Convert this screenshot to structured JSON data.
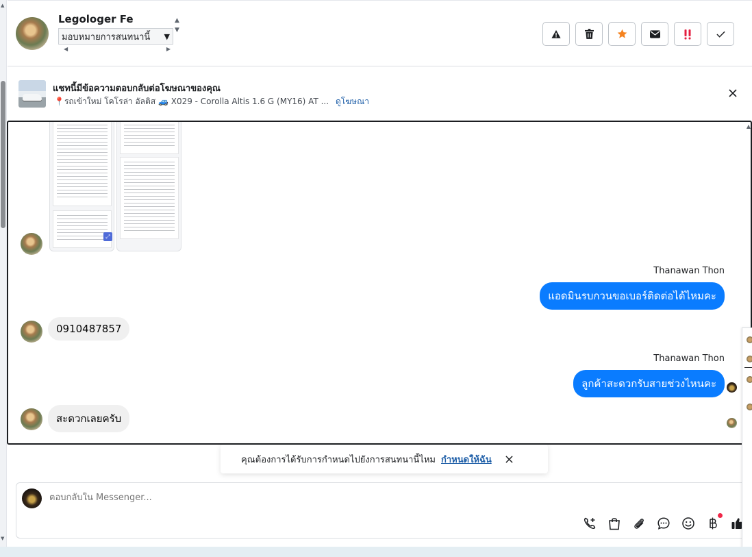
{
  "header": {
    "contact_name": "Legologer Fe",
    "assign_select": {
      "selected": "มอบหมายการสนทนานี้"
    },
    "actions": [
      {
        "name": "report-spam-button",
        "icon": "warning-icon",
        "color": "#1c1e21"
      },
      {
        "name": "delete-button",
        "icon": "trash-icon",
        "color": "#1c1e21"
      },
      {
        "name": "star-button",
        "icon": "star-icon",
        "color": "#f5821f"
      },
      {
        "name": "mark-unread-button",
        "icon": "envelope-icon",
        "color": "#1c1e21"
      },
      {
        "name": "follow-up-button",
        "icon": "double-exclamation-icon",
        "color": "#e41e3f"
      },
      {
        "name": "mark-done-button",
        "icon": "check-icon",
        "color": "#1c1e21"
      }
    ]
  },
  "ad_banner": {
    "title": "แชทนี้มีข้อความตอบกลับต่อโฆษณาของคุณ",
    "subtitle_pin": "📍",
    "subtitle": "รถเข้าใหม่ โคโรล่า อัลติส 🚙 X029 - Corolla Altis 1.6 G (MY16) AT ...",
    "view_ad_link": "ดูโฆษณา"
  },
  "messages": [
    {
      "type": "incoming_attachment",
      "from": "Legologer Fe"
    },
    {
      "type": "outgoing",
      "sender": "Thanawan Thon",
      "text": "แอดมินรบกวนขอเบอร์ติดต่อได้ไหมคะ"
    },
    {
      "type": "incoming",
      "text": "0910487857"
    },
    {
      "type": "outgoing",
      "sender": "Thanawan Thon",
      "text": "ลูกค้าสะดวกรับสายช่วงไหนคะ"
    },
    {
      "type": "incoming",
      "text": "สะดวกเลยครับ"
    }
  ],
  "assign_notice": {
    "text": "คุณต้องการได้รับการกำหนดไปยังการสนทนานี้ไหม",
    "link": "กำหนดให้ฉัน"
  },
  "composer": {
    "placeholder": "ตอบกลับใน Messenger...",
    "tools": [
      "phone-add-icon",
      "shopping-bag-icon",
      "paperclip-icon",
      "chat-bubble-icon",
      "emoji-icon",
      "baht-icon",
      "thumbs-up-icon"
    ],
    "accent_color": "#0a7cff"
  },
  "colors": {
    "outgoing_bubble": "#0a7cff",
    "incoming_bubble": "#f0f0f0",
    "link": "#1f5fa8"
  }
}
